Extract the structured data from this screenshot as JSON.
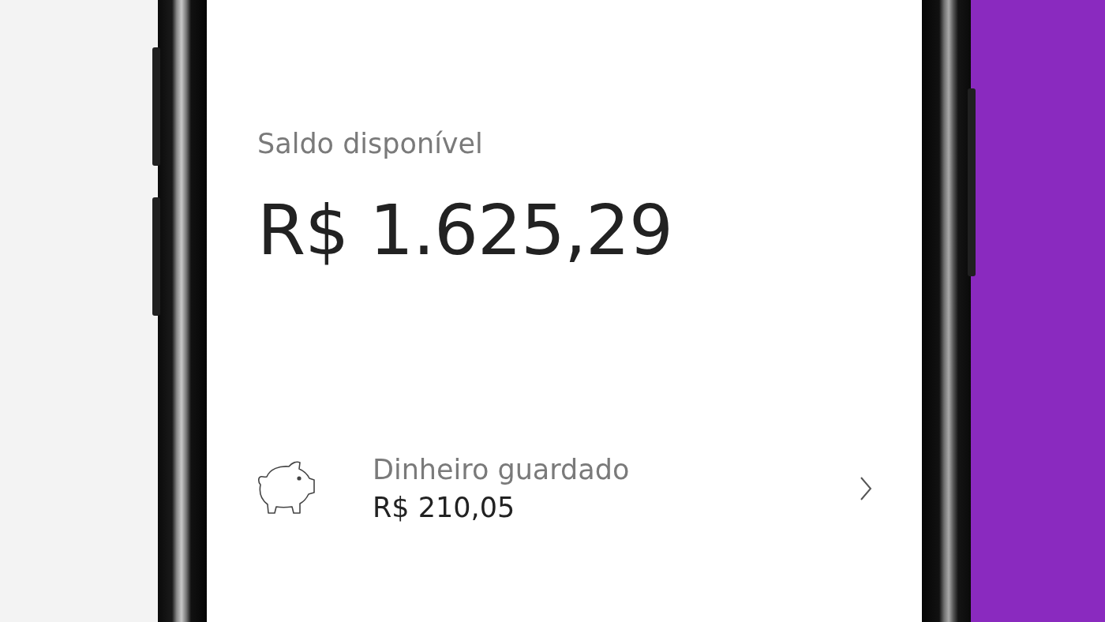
{
  "balance": {
    "label": "Saldo disponível",
    "amount": "R$ 1.625,29"
  },
  "savings": {
    "label": "Dinheiro guardado",
    "amount": "R$ 210,05"
  }
}
